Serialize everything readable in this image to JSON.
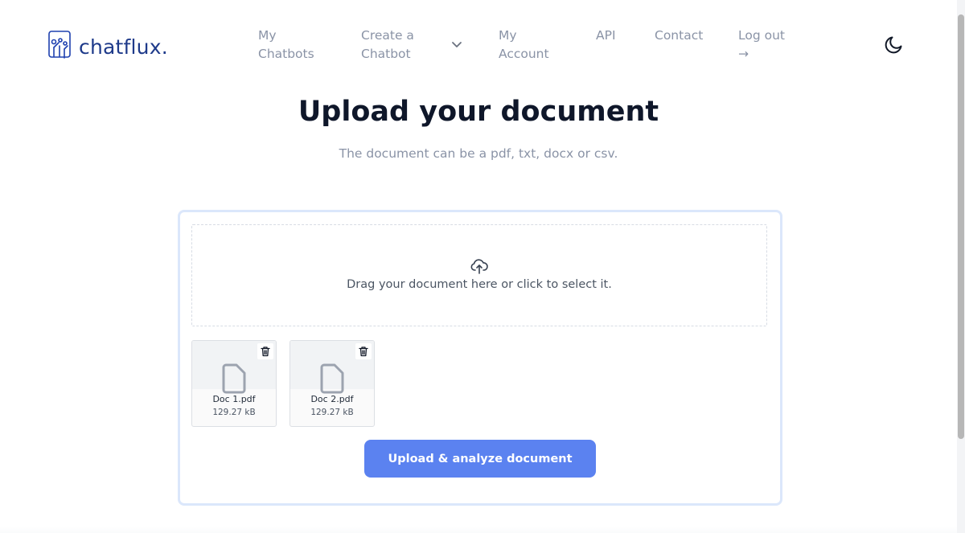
{
  "brand": {
    "name": "chatflux.",
    "logo_icon": "chatflux-logo-icon",
    "color": "#1e3a8a"
  },
  "nav": {
    "my_chatbots": [
      "My",
      "Chatbots"
    ],
    "create_chatbot": [
      "Create a",
      "Chatbot"
    ],
    "my_account": [
      "My",
      "Account"
    ],
    "api": "API",
    "contact": "Contact",
    "logout": [
      "Log out",
      "→"
    ]
  },
  "theme_toggle": {
    "icon": "moon-icon"
  },
  "page": {
    "title": "Upload your document",
    "subtitle": "The document can be a pdf, txt, docx or csv."
  },
  "dropzone": {
    "icon": "cloud-upload-icon",
    "text": "Drag your document here or click to select it."
  },
  "files": [
    {
      "name": "Doc 1.pdf",
      "size": "129.27 kB",
      "icon": "file-icon",
      "delete_icon": "trash-icon"
    },
    {
      "name": "Doc 2.pdf",
      "size": "129.27 kB",
      "icon": "file-icon",
      "delete_icon": "trash-icon"
    }
  ],
  "upload_button": {
    "label": "Upload & analyze document",
    "color": "#5b82f0"
  }
}
